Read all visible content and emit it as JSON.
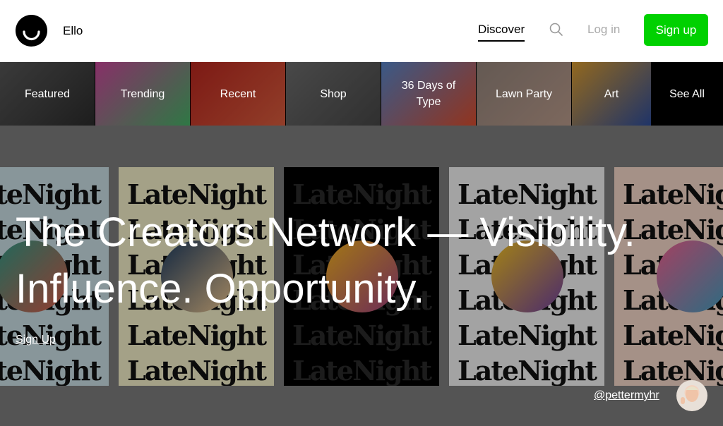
{
  "header": {
    "brand": "Ello",
    "nav": {
      "discover": "Discover",
      "login": "Log in",
      "signup": "Sign up"
    }
  },
  "categories": [
    {
      "label": "Featured",
      "colors": [
        "#5a5a5a",
        "#2e2e2e"
      ]
    },
    {
      "label": "Trending",
      "colors": [
        "#d04aa0",
        "#49b86a"
      ]
    },
    {
      "label": "Recent",
      "colors": [
        "#c02820",
        "#e06040"
      ]
    },
    {
      "label": "Shop",
      "colors": [
        "#707070",
        "#4a4a4a"
      ]
    },
    {
      "label": "36 Days of Type",
      "colors": [
        "#5a8ad0",
        "#e05030"
      ]
    },
    {
      "label": "Lawn Party",
      "colors": [
        "#9a8a80",
        "#c0a090"
      ]
    },
    {
      "label": "Art",
      "colors": [
        "#e0a030",
        "#3050a0"
      ]
    },
    {
      "label": "See All"
    }
  ],
  "hero": {
    "headline": "The Creators Network — Visibility. Influence. Opportunity.",
    "signup_link": "Sign Up",
    "credit": "@pettermyhr",
    "poster_word": "LateNight",
    "posters": [
      {
        "bg": "#c9dde4",
        "orb": [
          "#2f9a86",
          "#d85a48"
        ],
        "ink": "#111"
      },
      {
        "bg": "#f2eec8",
        "orb": [
          "#1e3c60",
          "#f0c890"
        ],
        "ink": "#111"
      },
      {
        "bg": "#000000",
        "orb": [
          "#f0b020",
          "#a04080"
        ],
        "ink": "#2a2a2a"
      },
      {
        "bg": "#f0f0f0",
        "orb": [
          "#f0c020",
          "#7040a0"
        ],
        "ink": "#111"
      },
      {
        "bg": "#f4d6c8",
        "orb": [
          "#f06090",
          "#40a0c0"
        ],
        "ink": "#111"
      }
    ]
  }
}
